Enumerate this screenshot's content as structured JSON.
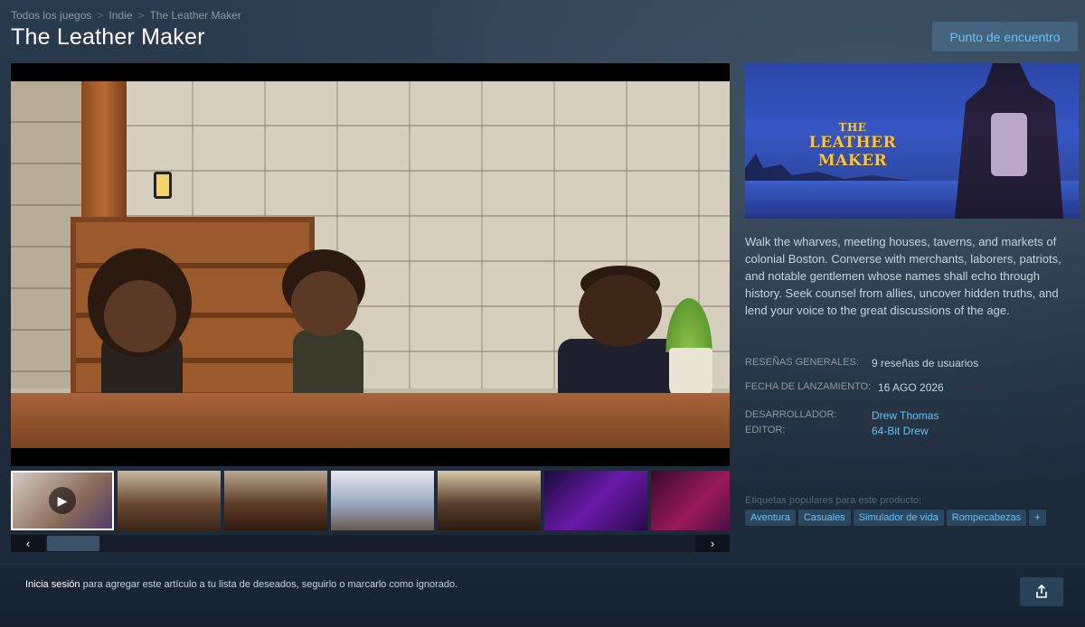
{
  "breadcrumb": [
    "Todos los juegos",
    "Indie",
    "The Leather Maker"
  ],
  "breadcrumb_sep": ">",
  "title": "The Leather Maker",
  "community_button": "Punto de encuentro",
  "capsule": {
    "the": "THE",
    "main": "LEATHER MAKER"
  },
  "description": "Walk the wharves, meeting houses, taverns, and markets of colonial Boston. Converse with merchants, laborers, patriots, and notable gentlemen whose names shall echo through history. Seek counsel from allies, uncover hidden truths, and lend your voice to the great discussions of the age.",
  "info": {
    "reviews_label": "RESEÑAS GENERALES:",
    "reviews_value": "9 reseñas de usuarios",
    "release_label": "FECHA DE LANZAMIENTO:",
    "release_value": "16 AGO 2026",
    "developer_label": "DESARROLLADOR:",
    "developer_value": "Drew Thomas",
    "publisher_label": "EDITOR:",
    "publisher_value": "64-Bit Drew"
  },
  "tags_label": "Etiquetas populares para este producto:",
  "tags": [
    "Aventura",
    "Casuales",
    "Simulador de vida",
    "Rompecabezas",
    "+"
  ],
  "bottom": {
    "login_link": "Inicia sesión",
    "text": " para agregar este artículo a tu lista de deseados, seguirlo o marcarlo como ignorado."
  },
  "icons": {
    "prev": "‹",
    "next": "›",
    "play": "▶",
    "share": "share-icon"
  },
  "thumb_colors": [
    "#8a6a5a",
    "#6a4a34",
    "#5e3e28",
    "#9aa8c0",
    "#5a4030",
    "#3a1a6a",
    "#4a1a5a"
  ],
  "colors": {
    "accent": "#67c1f5",
    "text": "#c6d4df",
    "muted": "#8f98a0"
  }
}
